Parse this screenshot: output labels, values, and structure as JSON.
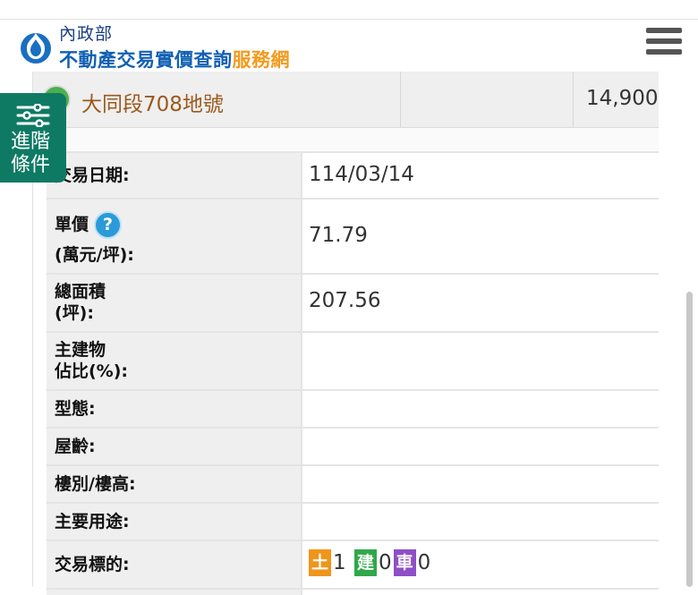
{
  "header": {
    "ministry": "內政部",
    "title_main": "不動產交易實價查詢",
    "title_accent": "服務網",
    "logo_icon": "ministry-logo-icon",
    "menu_icon": "hamburger-menu-icon"
  },
  "side_button": {
    "line1": "進階",
    "line2": "條件",
    "icon": "sliders-icon"
  },
  "previous_row": {
    "name": "大同段708地號",
    "price": "14,900"
  },
  "details": {
    "date_label": "交易日期:",
    "date_value": "114/03/14",
    "unit_price_label_1": "單價",
    "unit_price_label_2": "(萬元/坪):",
    "unit_price_value": "71.79",
    "help_icon": "?",
    "area_label_1": "總面積",
    "area_label_2": "(坪):",
    "area_value": "207.56",
    "main_building_label_1": "主建物",
    "main_building_label_2": "佔比(%):",
    "type_label": "型態:",
    "age_label": "屋齡:",
    "floor_label": "樓別/樓高:",
    "usage_label": "主要用途:",
    "target_label": "交易標的:",
    "target": {
      "land_tag": "土",
      "land_count": "1",
      "building_tag": "建",
      "building_count": "0",
      "car_tag": "車",
      "car_count": "0"
    }
  },
  "colors": {
    "brand_blue": "#1160b3",
    "accent_orange": "#f39a1e",
    "side_button_green": "#0f7a64",
    "land_orange": "#f0951a",
    "building_green": "#2ea84a",
    "car_purple": "#8e4fc7"
  }
}
